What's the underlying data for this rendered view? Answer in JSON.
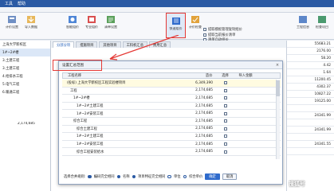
{
  "titlebar": {
    "items": [
      "工具",
      "帮助"
    ]
  },
  "ribbon": {
    "buttons": [
      {
        "label": "计价设置"
      },
      {
        "label": "导入数据"
      },
      {
        "label": "智能组价"
      },
      {
        "label": "专业组价"
      },
      {
        "label": "清单设置"
      },
      {
        "label": "快速组价"
      },
      {
        "label": "计价检查"
      }
    ],
    "quick_list": [
      "提取模板管理复制组价",
      "提取当前报价清单",
      "清单自动组价",
      "提取模板新建清单组价"
    ],
    "right_buttons": [
      "工程信息",
      "检查项目"
    ]
  },
  "left_panel": {
    "items": [
      "上海大学新校区",
      "1#~2#楼",
      "3.土建工程",
      "3.土建工程",
      "4.给排水工程",
      "5.电气工程",
      "6.暖通工程"
    ],
    "values": [
      "2,174,685"
    ]
  },
  "tabs": [
    "分部分项",
    "措施项目",
    "其他项目",
    "工料机汇总",
    "费用汇总"
  ],
  "right_numbers": [
    "55683.21",
    "2176.00",
    "58.20",
    "4.42",
    "1.64",
    "11200.45",
    "4302.37",
    "10827.22",
    "19125.00",
    "",
    "24341.99",
    "",
    "24341.99",
    "",
    "24341.55",
    ""
  ],
  "dialog": {
    "title": "设置汇总范围",
    "columns": [
      "工程名称",
      "造价",
      "选择",
      "导入金额"
    ],
    "rows": [
      {
        "name": "(投标) 上海大学新校区工程实验楼项目",
        "value": "6,349,390"
      },
      {
        "name": "工程",
        "value": "2,174,685"
      },
      {
        "name": "1#~2#楼",
        "value": "2,174,685"
      },
      {
        "name": "1#~2#土建工程",
        "value": "2,174,685"
      },
      {
        "name": "1#~2#安装工程",
        "value": "2,174,685"
      },
      {
        "name": "综合工程",
        "value": "2,174,685"
      },
      {
        "name": "综合土建工程",
        "value": "2,174,685"
      },
      {
        "name": "1#~2#土建工程",
        "value": "2,174,685"
      },
      {
        "name": "1#~2#安装工程",
        "value": "2,174,685"
      },
      {
        "name": "综合工程安装给水",
        "value": "2,174,685"
      }
    ],
    "footer": {
      "label": "选择合并规则:",
      "options": [
        "编码完全相同",
        "名称",
        "项目特征完全相同",
        "单位",
        "综合单价"
      ],
      "buttons": [
        "确定",
        "取消"
      ]
    }
  },
  "watermark": "搜狐号"
}
